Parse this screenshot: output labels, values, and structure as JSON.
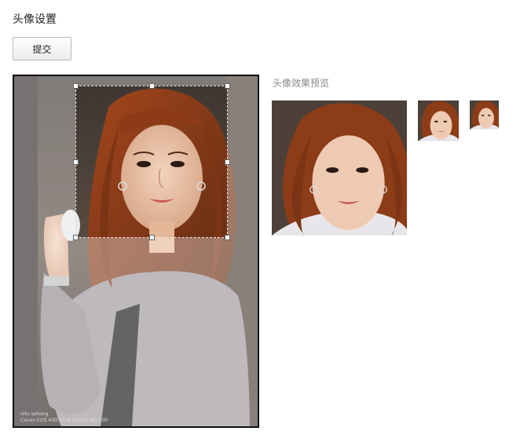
{
  "page": {
    "title": "头像设置"
  },
  "toolbar": {
    "submit_label": "提交"
  },
  "editor": {
    "watermark_line1": "nitu sohong",
    "watermark_line2": "Canon EOS 40D   f/2.8   1/400s   ISO 100"
  },
  "preview": {
    "title": "头像效果预览",
    "sizes": [
      "large",
      "medium",
      "small"
    ]
  },
  "icons": {
    "crop_handles": "square-handle"
  }
}
